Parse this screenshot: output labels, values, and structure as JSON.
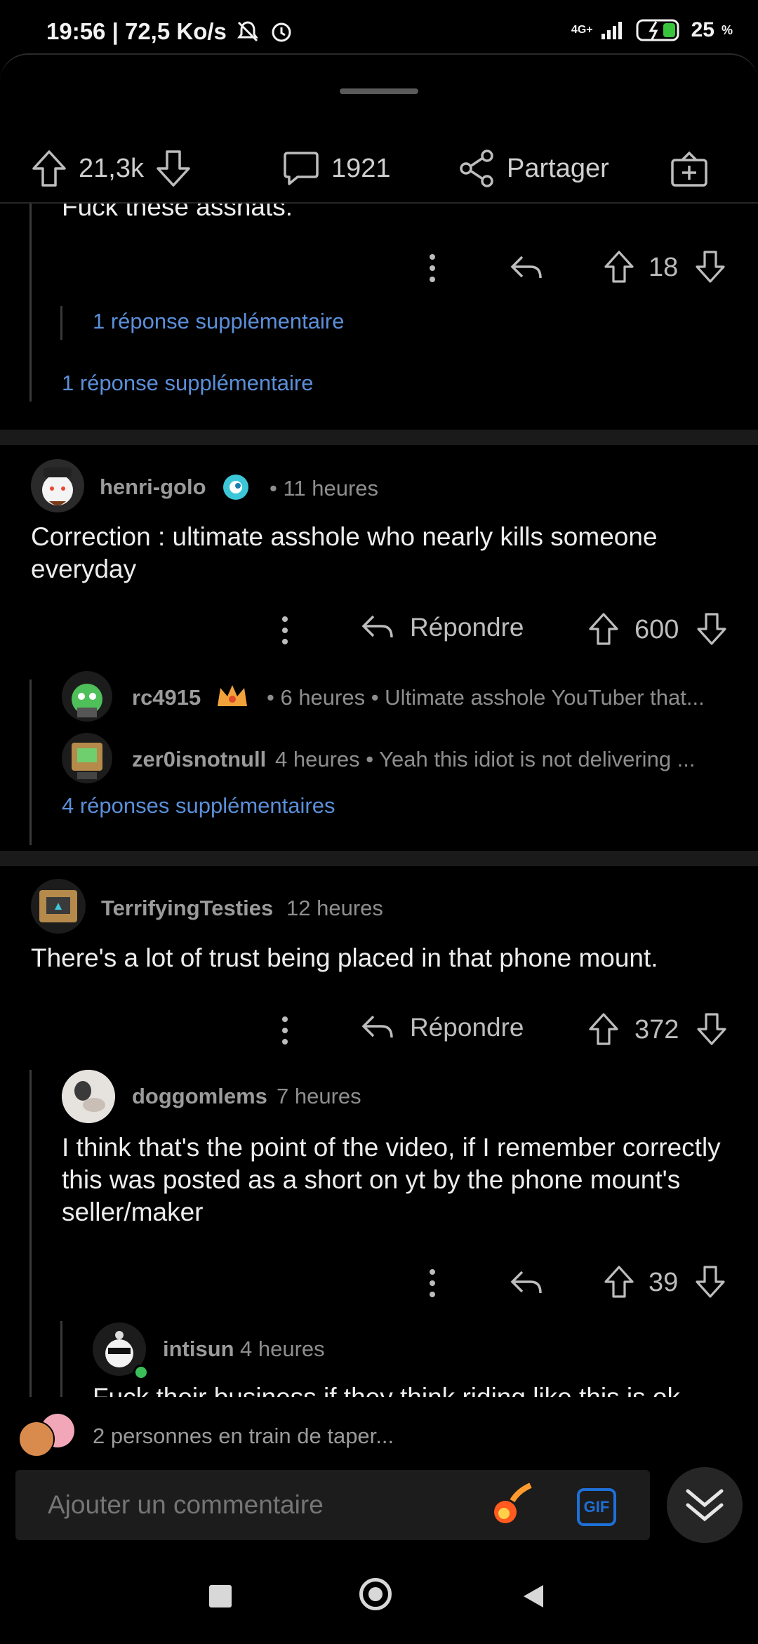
{
  "status_bar": {
    "time_speed": "19:56 | 72,5 Ko/s",
    "network": "4G+",
    "battery": "25",
    "battery_unit": "%"
  },
  "action_bar": {
    "upvotes": "21,3k",
    "comments": "1921",
    "share": "Partager"
  },
  "top_fragment": {
    "text": "Fuck these asshats.",
    "votes": "18",
    "more_replies_nested": "1 réponse supplémentaire",
    "more_replies": "1 réponse supplémentaire"
  },
  "comments": [
    {
      "username": "henri-golo",
      "time": "• 11 heures",
      "text": "Correction : ultimate asshole who nearly kills someone everyday",
      "reply_label": "Répondre",
      "votes": "600",
      "replies": [
        {
          "username": "rc4915",
          "meta": "• 6 heures • Ultimate asshole YouTuber that..."
        },
        {
          "username": "zer0isnotnull",
          "meta": "4 heures • Yeah this idiot is not delivering ..."
        }
      ],
      "more_replies": "4 réponses supplémentaires"
    },
    {
      "username": "TerrifyingTesties",
      "time": "12 heures",
      "text": "There's a lot of trust being placed in that phone mount.",
      "reply_label": "Répondre",
      "votes": "372"
    }
  ],
  "nested_reply": {
    "username": "doggomlems",
    "time": "7 heures",
    "text": "I think that's the point of the video, if I remember correctly this was posted as a short on yt by the phone mount's seller/maker",
    "votes": "39"
  },
  "deep_reply": {
    "username": "intisun",
    "time": "4 heures",
    "text_partial": "Fuck their business if they think riding like this is ok"
  },
  "typing": {
    "text": "2 personnes en train de taper..."
  },
  "composer": {
    "placeholder": "Ajouter un commentaire",
    "gif_label": "GIF"
  },
  "colors": {
    "background": "#000000",
    "link": "#5b8fd9",
    "gif_blue": "#1e6fd6",
    "band": "#1a1a1a"
  }
}
